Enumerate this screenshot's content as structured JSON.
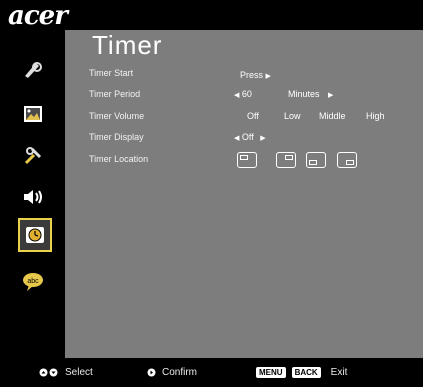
{
  "brand": "acer",
  "page_title": "Timer",
  "sidebar": {
    "items": [
      {
        "icon": "color-palette-icon"
      },
      {
        "icon": "image-icon"
      },
      {
        "icon": "tools-settings-icon"
      },
      {
        "icon": "speaker-icon"
      },
      {
        "icon": "timer-clock-icon",
        "active": true
      },
      {
        "icon": "language-bubble-icon"
      }
    ]
  },
  "settings": {
    "timer_start": {
      "label": "Timer Start",
      "value": "Press"
    },
    "timer_period": {
      "label": "Timer Period",
      "value": "60",
      "unit": "Minutes"
    },
    "timer_volume": {
      "label": "Timer Volume",
      "options": [
        "Off",
        "Low",
        "Middle",
        "High"
      ]
    },
    "timer_display": {
      "label": "Timer Display",
      "value": "Off"
    },
    "timer_location": {
      "label": "Timer Location"
    }
  },
  "footer": {
    "select": "Select",
    "confirm": "Confirm",
    "menu_key": "MENU",
    "back_key": "BACK",
    "exit": "Exit"
  }
}
